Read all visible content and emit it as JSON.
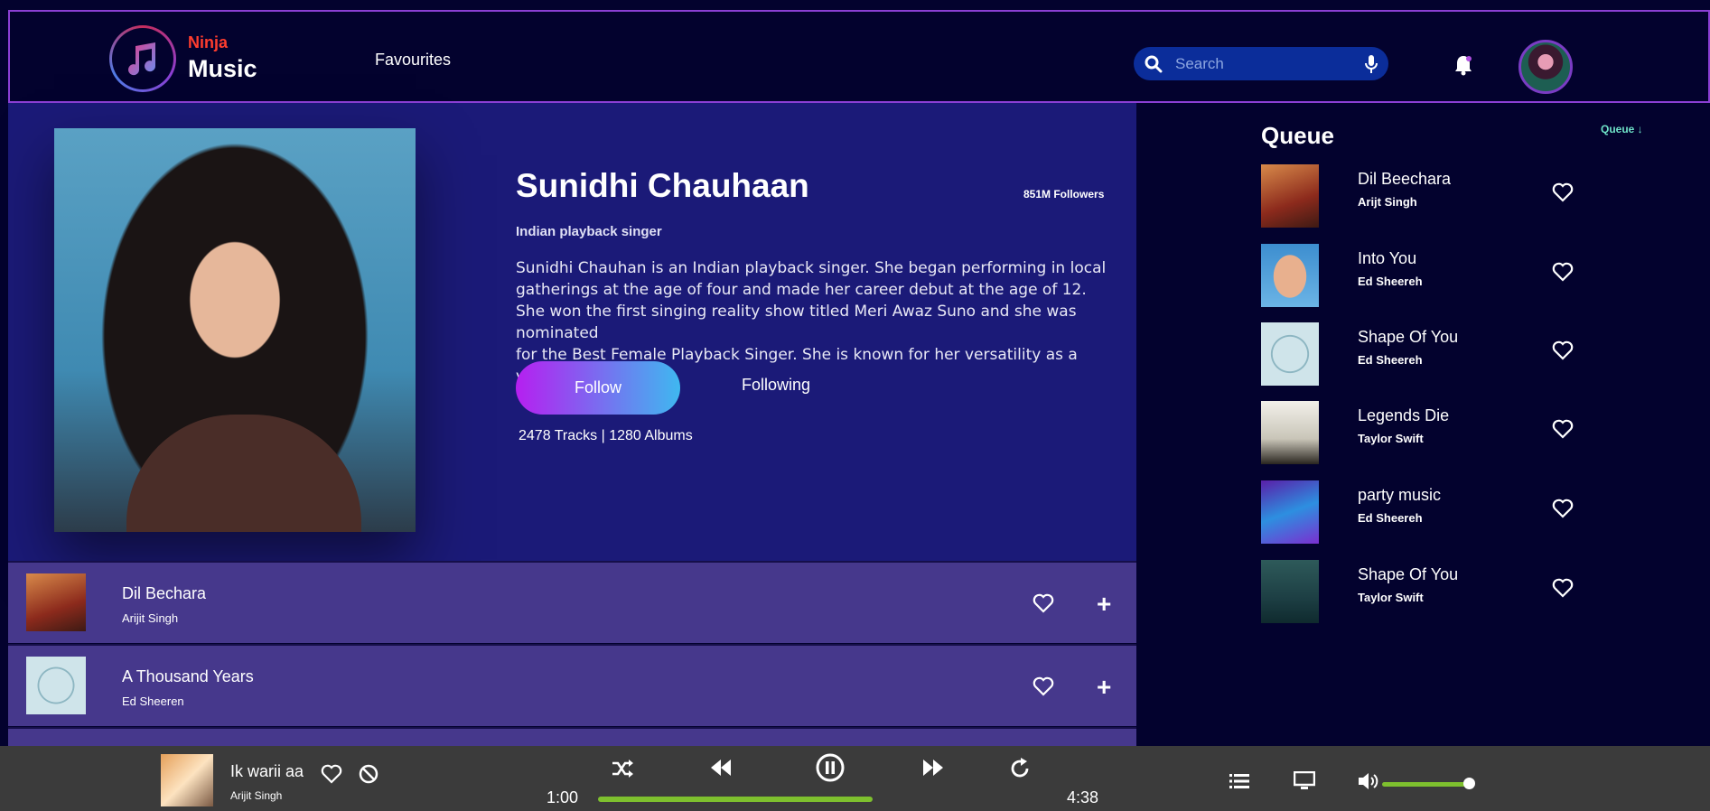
{
  "header": {
    "brand_top": "Ninja",
    "brand_bottom": "Music",
    "nav_favourites": "Favourites",
    "search_placeholder": "Search"
  },
  "artist": {
    "name": "Sunidhi Chauhaan",
    "followers": "851M Followers",
    "role": "Indian playback singer",
    "bio_line1": "Sunidhi Chauhan is an Indian playback singer. She began performing in local",
    "bio_line2": "gatherings at the age of four and made her career debut at the age of 12.",
    "bio_line3": "She won the first singing reality show titled Meri Awaz Suno and she was nominated",
    "bio_line4": "for the Best Female Playback Singer. She is known for her versatility as a vocalist.",
    "follow_label": "Follow",
    "following_label": "Following",
    "stats": "2478 Tracks | 1280 Albums"
  },
  "tracks": [
    {
      "title": "Dil Bechara",
      "artist": "Arijit Singh"
    },
    {
      "title": "A Thousand Years",
      "artist": "Ed Sheeren"
    }
  ],
  "queue": {
    "title": "Queue",
    "link": "Queue ↓",
    "items": [
      {
        "title": "Dil Beechara",
        "artist": "Arijt Singh"
      },
      {
        "title": "Into You",
        "artist": "Ed Sheereh"
      },
      {
        "title": "Shape Of You",
        "artist": "Ed Sheereh"
      },
      {
        "title": "Legends Die",
        "artist": "Taylor Swift"
      },
      {
        "title": "party music",
        "artist": "Ed Sheereh"
      },
      {
        "title": "Shape Of You",
        "artist": "Taylor Swift"
      }
    ]
  },
  "player": {
    "title": "Ik warii aa",
    "artist": "Arijit Singh",
    "current_time": "1:00",
    "total_time": "4:38",
    "progress_fraction": 0.22,
    "volume_fraction": 0.95
  },
  "colors": {
    "accent_purple": "#8b3fd4",
    "brand_red": "#ff3d2e",
    "progress_green": "#7ec02e",
    "queue_link": "#6fe3c9"
  }
}
